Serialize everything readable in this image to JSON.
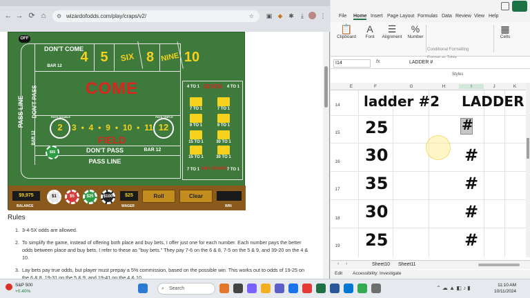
{
  "browser": {
    "url": "wizardofodds.com/play/craps/v2/",
    "nav": [
      "←",
      "→",
      "⟳",
      "⌂"
    ]
  },
  "craps": {
    "off_label": "OFF",
    "dont_come": "DON'T COME",
    "bar12": "BAR 12",
    "numbers": [
      "4",
      "5",
      "SIX",
      "8",
      "NINE",
      "10"
    ],
    "pass_line_vertical": "PASS LINE",
    "dont_pass_vertical": "DON'T PASS",
    "bar12_vertical": "BAR 12",
    "come": "COME",
    "field_numbers": [
      "3",
      "•",
      "4",
      "•",
      "9",
      "•",
      "10",
      "•",
      "11"
    ],
    "field_2": "2",
    "field_12": "12",
    "pays_double": "PAYS DOUBLE",
    "pays_triple": "PAYS TRIPLE",
    "field": "FIELD",
    "dont_pass": "DON'T PASS",
    "bar12_b": "BAR 12",
    "pass_line": "PASS LINE",
    "chip_on_table": "$55",
    "props": {
      "four_to_one_left": "4 TO 1",
      "seven": "SEVEN",
      "four_to_one_right": "4 TO 1",
      "odds": [
        "7 TO 1",
        "7 TO 1",
        "9 TO 1",
        "9 TO 1"
      ],
      "horn_left": "15 TO 1",
      "horn_right": "30 TO 1",
      "horn2_left": "15 TO 1",
      "horn2_right": "30 TO 1",
      "any_left": "7 TO 1",
      "any_craps": "ANY CRAPS",
      "any_right": "7 TO 1"
    },
    "bar": {
      "balance": "$9,975",
      "balance_caption": "BALANCE",
      "chips": [
        "$1",
        "$5",
        "$25",
        "$100"
      ],
      "wager": "$25",
      "wager_caption": "WAGER",
      "roll": "Roll",
      "clear": "Clear",
      "win": "",
      "win_caption": "WIN"
    }
  },
  "rules": {
    "heading": "Rules",
    "items": [
      "3-4-5X odds are allowed.",
      "To simplify the game, instead of offering both place and buy bets, I offer just one for each number. Each number pays the better odds between place and buy bets. I refer to these as \"buy bets.\" They pay 7-6 on the 6 & 8, 7-5 on the 5 & 9, and 39-20 on the 4 & 10.",
      "Lay bets pay true odds, but player must prepay a 5% commission, based on the possible win. This works out to odds of 19-25 on the 6 & 8, 19-31 on the 5 & 9, and 19-41 on the 4 & 10."
    ]
  },
  "excel": {
    "ribbon_tabs": [
      "File",
      "Home",
      "Insert",
      "Page Layout",
      "Formulas",
      "Data",
      "Review",
      "View",
      "Help"
    ],
    "groups": {
      "clipboard": "Clipboard",
      "font": "Font",
      "alignment": "Alignment",
      "number": "Number",
      "conditional": "Conditional Formatting",
      "format_table": "Format as Table",
      "cell_styles": "Cell Styles",
      "styles": "Styles",
      "cells": "Cells"
    },
    "name_box": "I14",
    "fx": "fx",
    "formula": "LADDER #",
    "columns": [
      "E",
      "F",
      "G",
      "H",
      "I",
      "J",
      "K"
    ],
    "rows": [
      {
        "n": "14",
        "f": "ladder #2",
        "i": "LADDER"
      },
      {
        "n": "15",
        "f": "25",
        "i": "#"
      },
      {
        "n": "16",
        "f": "30",
        "i": "#"
      },
      {
        "n": "17",
        "f": "35",
        "i": "#"
      },
      {
        "n": "18",
        "f": "30",
        "i": "#"
      },
      {
        "n": "19",
        "f": "25",
        "i": "#"
      }
    ],
    "sheets": [
      "Sheet10",
      "Sheet11"
    ],
    "status_edit": "Edit",
    "status_access": "Accessibility: Investigate"
  },
  "taskbar": {
    "stock_name": "S&P 500",
    "stock_change": "+0.40%",
    "search": "Search",
    "time": "11:10 AM",
    "date": "10/11/2024"
  }
}
